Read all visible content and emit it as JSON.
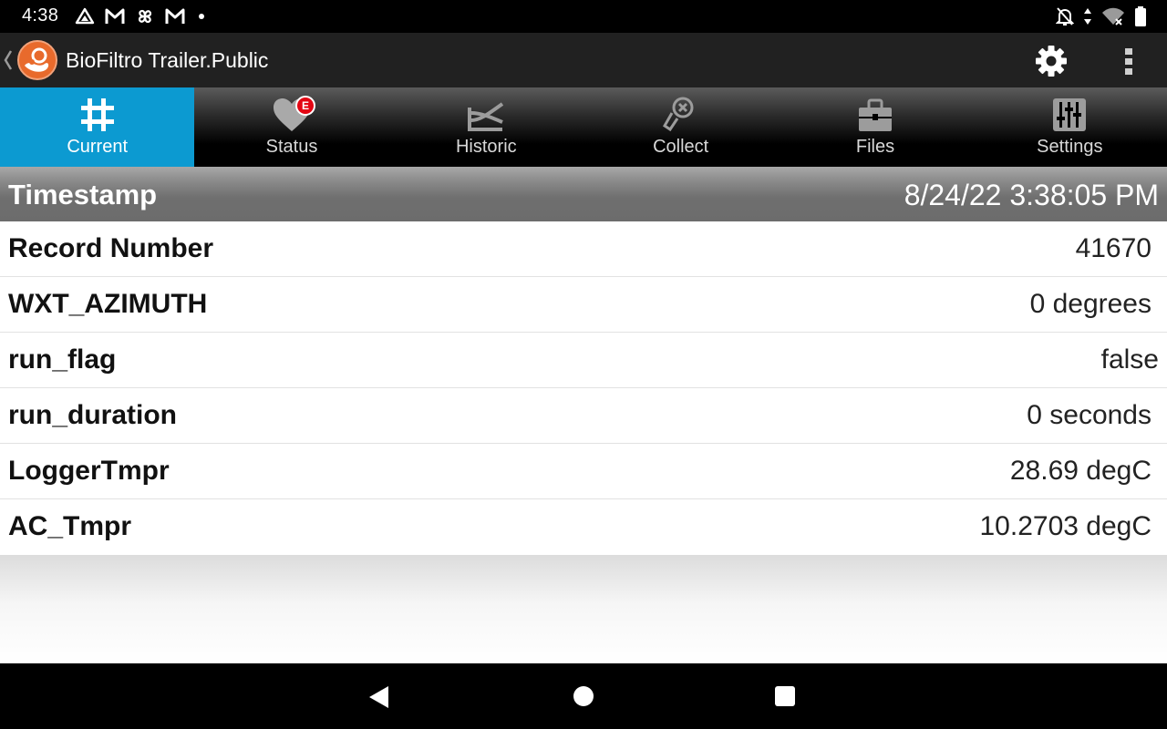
{
  "status_bar": {
    "time": "4:38",
    "left_icons": [
      "drive-icon",
      "gmail-icon",
      "pinwheel-icon",
      "gmail-icon",
      "dot-icon"
    ],
    "right_icons": [
      "notifications-off-icon",
      "data-arrows-icon",
      "wifi-off-icon",
      "battery-icon"
    ]
  },
  "app_bar": {
    "title": "BioFiltro Trailer.Public"
  },
  "tabs": [
    {
      "label": "Current",
      "icon": "grid-icon",
      "active": true
    },
    {
      "label": "Status",
      "icon": "heart-icon",
      "badge": "E"
    },
    {
      "label": "Historic",
      "icon": "historic-icon"
    },
    {
      "label": "Collect",
      "icon": "collect-icon"
    },
    {
      "label": "Files",
      "icon": "briefcase-icon"
    },
    {
      "label": "Settings",
      "icon": "sliders-icon"
    }
  ],
  "timestamp": {
    "label": "Timestamp",
    "value": "8/24/22 3:38:05 PM"
  },
  "rows": [
    {
      "label": "Record Number",
      "value": "41670"
    },
    {
      "label": "WXT_AZIMUTH",
      "value": "0 degrees"
    },
    {
      "label": "run_flag",
      "value": "false"
    },
    {
      "label": "run_duration",
      "value": "0 seconds"
    },
    {
      "label": "LoggerTmpr",
      "value": "28.69 degC"
    },
    {
      "label": "AC_Tmpr",
      "value": "10.2703 degC"
    }
  ],
  "colors": {
    "active_tab": "#0c9ad1",
    "badge": "#e30613",
    "logo": "#e86a2c"
  }
}
